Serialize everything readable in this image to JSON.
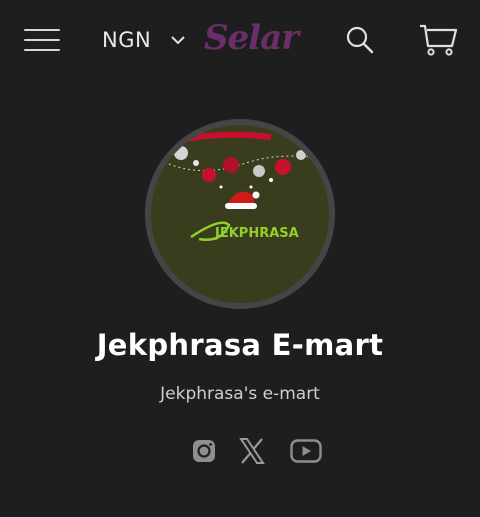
{
  "header": {
    "currency": "NGN",
    "logo_text": "Selar",
    "menu_icon": "hamburger-menu-icon",
    "search_icon": "search-icon",
    "cart_icon": "cart-icon"
  },
  "store": {
    "avatar_logo_text": "JEKPHRASA",
    "name": "Jekphrasa E-mart",
    "description": "Jekphrasa's e-mart"
  },
  "socials": [
    {
      "name": "instagram-icon"
    },
    {
      "name": "x-twitter-icon"
    },
    {
      "name": "youtube-icon"
    }
  ],
  "colors": {
    "background": "#1e1e1e",
    "logo": "#6a2f68",
    "avatar_bg": "#3a3d1d",
    "avatar_text": "#8fd12a"
  }
}
